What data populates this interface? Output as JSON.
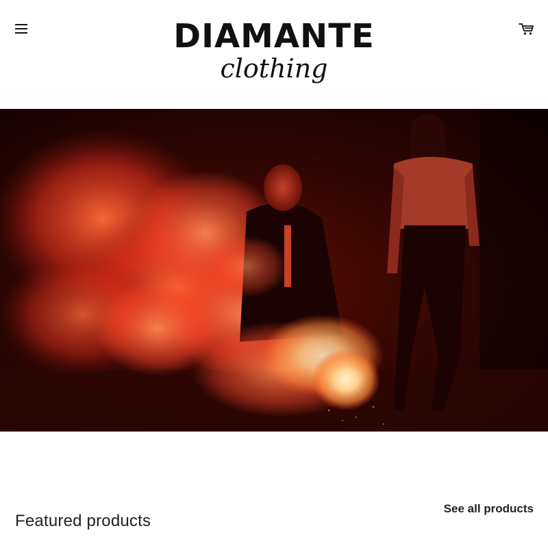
{
  "header": {
    "menu_icon": "hamburger-menu-icon",
    "cart_icon": "shopping-cart-icon",
    "logo": {
      "main": "DIAMANTE",
      "sub": "clothing"
    }
  },
  "hero": {
    "image": "two-women-red-smoke-flare-night"
  },
  "featured": {
    "title": "Featured products",
    "see_all_label": "See all products"
  },
  "colors": {
    "text": "#111111",
    "background": "#ffffff",
    "hero_dark": "#1a0302",
    "smoke": "#ff4a2a",
    "flare": "#ffd08a"
  }
}
